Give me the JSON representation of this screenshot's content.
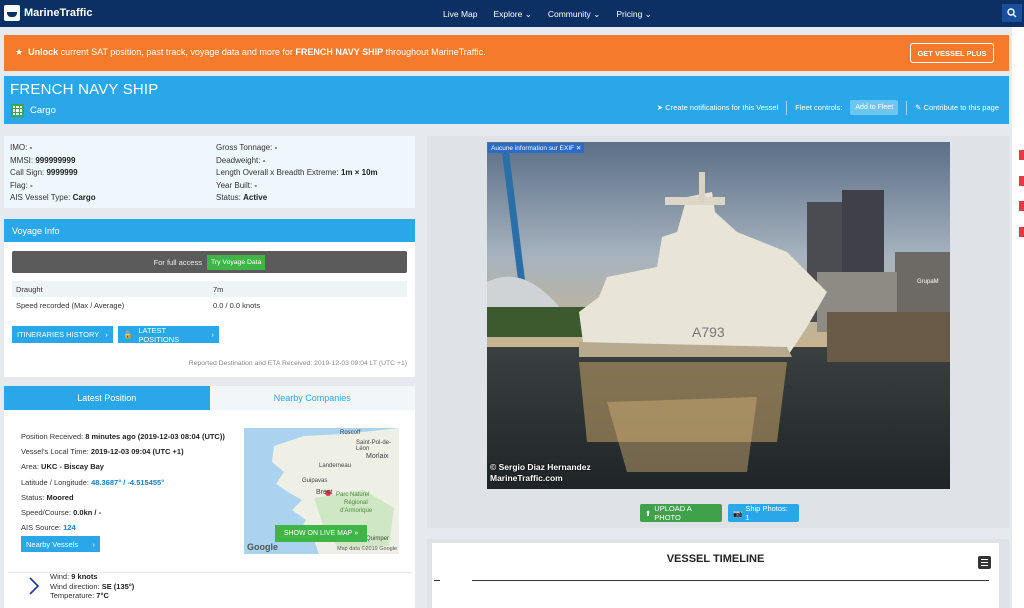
{
  "nav": {
    "logo": "MarineTraffic",
    "links": [
      "Live Map",
      "Explore",
      "Community",
      "Pricing"
    ]
  },
  "promo": {
    "unlock": "Unlock",
    "text1": " current SAT position, past track, voyage data and more for ",
    "ship": "FRENCH NAVY SHIP",
    "text2": " throughout MarineTraffic.",
    "button": "GET VESSEL PLUS"
  },
  "vessel": {
    "name": "FRENCH NAVY SHIP",
    "type": "Cargo",
    "notify": "Create notifications for this Vessel",
    "fleet_label": "Fleet controls:",
    "add_fleet": "Add to Fleet",
    "contribute": "Contribute to this page"
  },
  "info": {
    "left": [
      {
        "k": "IMO:",
        "v": "-"
      },
      {
        "k": "MMSI:",
        "v": "999999999"
      },
      {
        "k": "Call Sign:",
        "v": "9999999"
      },
      {
        "k": "Flag:",
        "v": "-"
      },
      {
        "k": "AIS Vessel Type:",
        "v": "Cargo"
      }
    ],
    "right": [
      {
        "k": "Gross Tonnage:",
        "v": "-"
      },
      {
        "k": "Deadweight:",
        "v": "-"
      },
      {
        "k": "Length Overall x Breadth Extreme:",
        "v": "1m × 10m"
      },
      {
        "k": "Year Built:",
        "v": "-"
      },
      {
        "k": "Status:",
        "v": "Active"
      }
    ]
  },
  "voyage": {
    "title": "Voyage Info",
    "full_access": "For full access",
    "try_button": "Try Voyage Data",
    "draught_label": "Draught",
    "draught_value": "7m",
    "speed_label": "Speed recorded (Max / Average)",
    "speed_value": "0.0 / 0.0 knots",
    "itineraries": "ITINERARIES HISTORY",
    "latest_positions": "LATEST POSITIONS",
    "reported": "Reported Destination and ETA Received: 2019-12-03 09:04 LT (UTC +1)"
  },
  "position": {
    "tab_latest": "Latest Position",
    "tab_nearby": "Nearby Companies",
    "received_label": "Position Received:",
    "received_value": "8 minutes ago (2019-12-03 08:04 (UTC))",
    "local_label": "Vessel's Local Time:",
    "local_value": "2019-12-03 09:04 (UTC +1)",
    "area_label": "Area:",
    "area_value": "UKC - Biscay Bay",
    "latlon_label": "Latitude / Longitude:",
    "latlon_value": "48.3687° / -4.515455°",
    "status_label": "Status:",
    "status_value": "Moored",
    "speed_label": "Speed/Course:",
    "speed_value": "0.0kn / -",
    "source_label": "AIS Source:",
    "source_value": "124",
    "nearby_button": "Nearby Vessels",
    "wind_label": "Wind:",
    "wind_value": "9  knots",
    "dir_label": "Wind direction:",
    "dir_value": "SE (135°)",
    "temp_label": "Temperature:",
    "temp_value": "7°C"
  },
  "map": {
    "places": [
      "Roscoff",
      "Saint-Pol-de-Léon",
      "Morlaix",
      "Landerneau",
      "Guipavas",
      "Brest",
      "Parc Naturel",
      "Régional",
      "d'Armorique",
      "Quimper"
    ],
    "show_button": "SHOW ON LIVE MAP",
    "google": "Google",
    "map_data": "Map data ©2019 Google"
  },
  "photo": {
    "exif": "Aucune information sur EXIF",
    "hull": "A793",
    "sign": "GrupaM",
    "credit1": "© Sergio Diaz Hernandez",
    "credit2": "MarineTraffic.com",
    "upload": "UPLOAD A PHOTO",
    "ship_photos": "Ship Photos: 1"
  },
  "timeline": {
    "title": "VESSEL TIMELINE"
  },
  "colors": {
    "nav": "#0c2f64",
    "promo": "#f47a2c",
    "accent": "#2aa7e8",
    "green": "#3fb548"
  }
}
